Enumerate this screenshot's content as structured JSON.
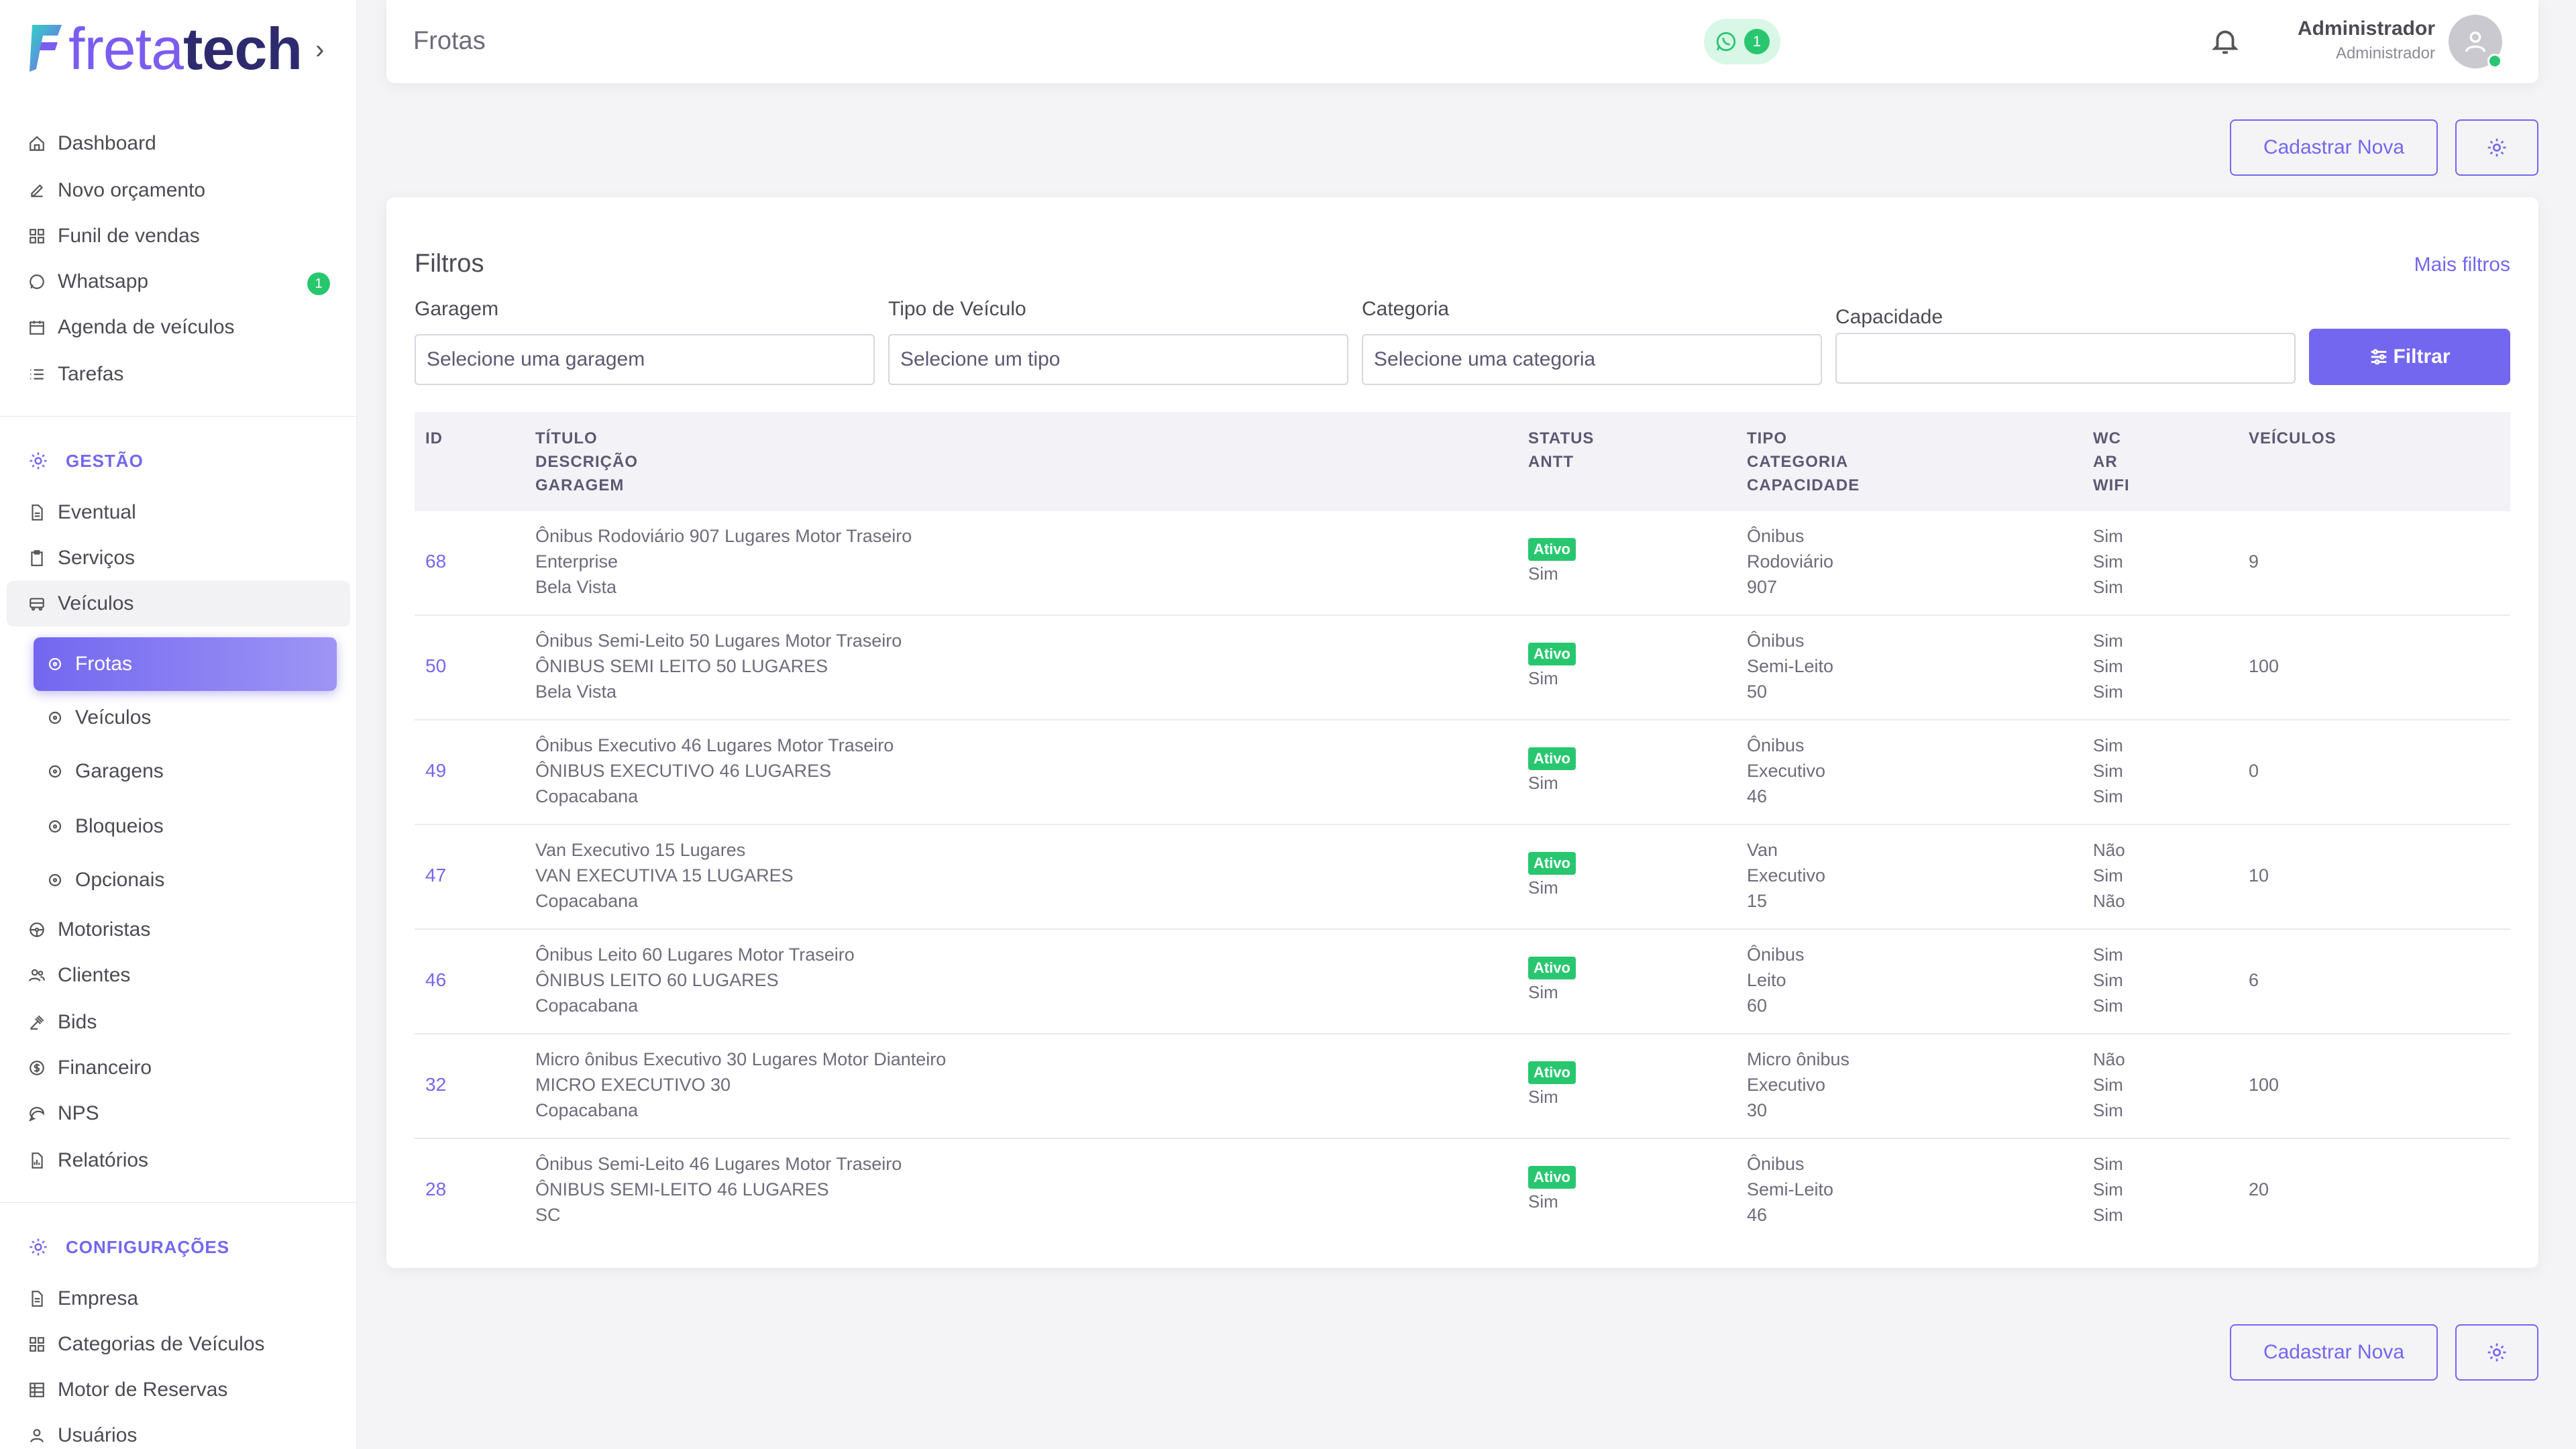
{
  "app": {
    "logo_part1": "freta",
    "logo_part2": "tech",
    "logo_chevron": "›"
  },
  "sidebar": {
    "main_items": [
      {
        "label": "Dashboard",
        "icon": "home-icon"
      },
      {
        "label": "Novo orçamento",
        "icon": "edit-icon"
      },
      {
        "label": "Funil de vendas",
        "icon": "funnel-icon"
      },
      {
        "label": "Whatsapp",
        "icon": "whatsapp-icon",
        "badge": "1"
      },
      {
        "label": "Agenda de veículos",
        "icon": "calendar-icon"
      },
      {
        "label": "Tarefas",
        "icon": "list-icon"
      }
    ],
    "gestao_title": "GESTÃO",
    "gestao_items": [
      {
        "label": "Eventual",
        "icon": "file-icon"
      },
      {
        "label": "Serviços",
        "icon": "clipboard-icon"
      },
      {
        "label": "Veículos",
        "icon": "bus-icon"
      }
    ],
    "veiculos_sub": [
      {
        "label": "Frotas",
        "active": true
      },
      {
        "label": "Veículos"
      },
      {
        "label": "Garagens"
      },
      {
        "label": "Bloqueios"
      },
      {
        "label": "Opcionais"
      }
    ],
    "gestao_items2": [
      {
        "label": "Motoristas",
        "icon": "steering-icon"
      },
      {
        "label": "Clientes",
        "icon": "users-icon"
      },
      {
        "label": "Bids",
        "icon": "gavel-icon"
      },
      {
        "label": "Financeiro",
        "icon": "dollar-icon"
      },
      {
        "label": "NPS",
        "icon": "chat-icon"
      },
      {
        "label": "Relatórios",
        "icon": "report-icon"
      }
    ],
    "config_title": "CONFIGURAÇÕES",
    "config_items": [
      {
        "label": "Empresa",
        "icon": "building-icon"
      },
      {
        "label": "Categorias de Veículos",
        "icon": "grid-icon"
      },
      {
        "label": "Motor de Reservas",
        "icon": "table-icon"
      },
      {
        "label": "Usuários",
        "icon": "user-icon"
      }
    ]
  },
  "header": {
    "title": "Frotas",
    "whatsapp_count": "1",
    "user_name": "Administrador",
    "user_role": "Administrador"
  },
  "actions": {
    "new_label": "Cadastrar Nova"
  },
  "filters": {
    "title": "Filtros",
    "more_label": "Mais filtros",
    "garagem_label": "Garagem",
    "garagem_placeholder": "Selecione uma garagem",
    "tipo_label": "Tipo de Veículo",
    "tipo_placeholder": "Selecione um tipo",
    "categoria_label": "Categoria",
    "categoria_placeholder": "Selecione uma categoria",
    "capacidade_label": "Capacidade",
    "capacidade_value": "",
    "filter_button": "Filtrar"
  },
  "table": {
    "headers": {
      "id": "ID",
      "titulo": "TÍTULO",
      "descricao": "DESCRIÇÃO",
      "garagem": "GARAGEM",
      "status": "STATUS",
      "antt": "ANTT",
      "tipo": "TIPO",
      "categoria": "CATEGORIA",
      "capacidade": "CAPACIDADE",
      "wc": "WC",
      "ar": "AR",
      "wifi": "WIFI",
      "veiculos": "VEÍCULOS"
    },
    "rows": [
      {
        "id": "68",
        "titulo": "Ônibus Rodoviário 907 Lugares Motor Traseiro",
        "descricao": "Enterprise",
        "garagem": "Bela Vista",
        "status": "Ativo",
        "antt": "Sim",
        "tipo": "Ônibus",
        "categoria": "Rodoviário",
        "capacidade": "907",
        "wc": "Sim",
        "ar": "Sim",
        "wifi": "Sim",
        "veiculos": "9"
      },
      {
        "id": "50",
        "titulo": "Ônibus Semi-Leito 50 Lugares Motor Traseiro",
        "descricao": "ÔNIBUS SEMI LEITO 50 LUGARES",
        "garagem": "Bela Vista",
        "status": "Ativo",
        "antt": "Sim",
        "tipo": "Ônibus",
        "categoria": "Semi-Leito",
        "capacidade": "50",
        "wc": "Sim",
        "ar": "Sim",
        "wifi": "Sim",
        "veiculos": "100"
      },
      {
        "id": "49",
        "titulo": "Ônibus Executivo 46 Lugares Motor Traseiro",
        "descricao": "ÔNIBUS EXECUTIVO 46 LUGARES",
        "garagem": "Copacabana",
        "status": "Ativo",
        "antt": "Sim",
        "tipo": "Ônibus",
        "categoria": "Executivo",
        "capacidade": "46",
        "wc": "Sim",
        "ar": "Sim",
        "wifi": "Sim",
        "veiculos": "0"
      },
      {
        "id": "47",
        "titulo": "Van Executivo 15 Lugares",
        "descricao": "VAN EXECUTIVA 15 LUGARES",
        "garagem": "Copacabana",
        "status": "Ativo",
        "antt": "Sim",
        "tipo": "Van",
        "categoria": "Executivo",
        "capacidade": "15",
        "wc": "Não",
        "ar": "Sim",
        "wifi": "Não",
        "veiculos": "10"
      },
      {
        "id": "46",
        "titulo": "Ônibus Leito 60 Lugares Motor Traseiro",
        "descricao": "ÔNIBUS LEITO 60 LUGARES",
        "garagem": "Copacabana",
        "status": "Ativo",
        "antt": "Sim",
        "tipo": "Ônibus",
        "categoria": "Leito",
        "capacidade": "60",
        "wc": "Sim",
        "ar": "Sim",
        "wifi": "Sim",
        "veiculos": "6"
      },
      {
        "id": "32",
        "titulo": "Micro ônibus Executivo 30 Lugares Motor Dianteiro",
        "descricao": "MICRO EXECUTIVO 30",
        "garagem": "Copacabana",
        "status": "Ativo",
        "antt": "Sim",
        "tipo": "Micro ônibus",
        "categoria": "Executivo",
        "capacidade": "30",
        "wc": "Não",
        "ar": "Sim",
        "wifi": "Sim",
        "veiculos": "100"
      },
      {
        "id": "28",
        "titulo": "Ônibus Semi-Leito 46 Lugares Motor Traseiro",
        "descricao": "ÔNIBUS SEMI-LEITO 46 LUGARES",
        "garagem": "SC",
        "status": "Ativo",
        "antt": "Sim",
        "tipo": "Ônibus",
        "categoria": "Semi-Leito",
        "capacidade": "46",
        "wc": "Sim",
        "ar": "Sim",
        "wifi": "Sim",
        "veiculos": "20"
      }
    ]
  },
  "colors": {
    "accent": "#7367f0",
    "success": "#28c76f",
    "muted": "#b9b9c3"
  }
}
